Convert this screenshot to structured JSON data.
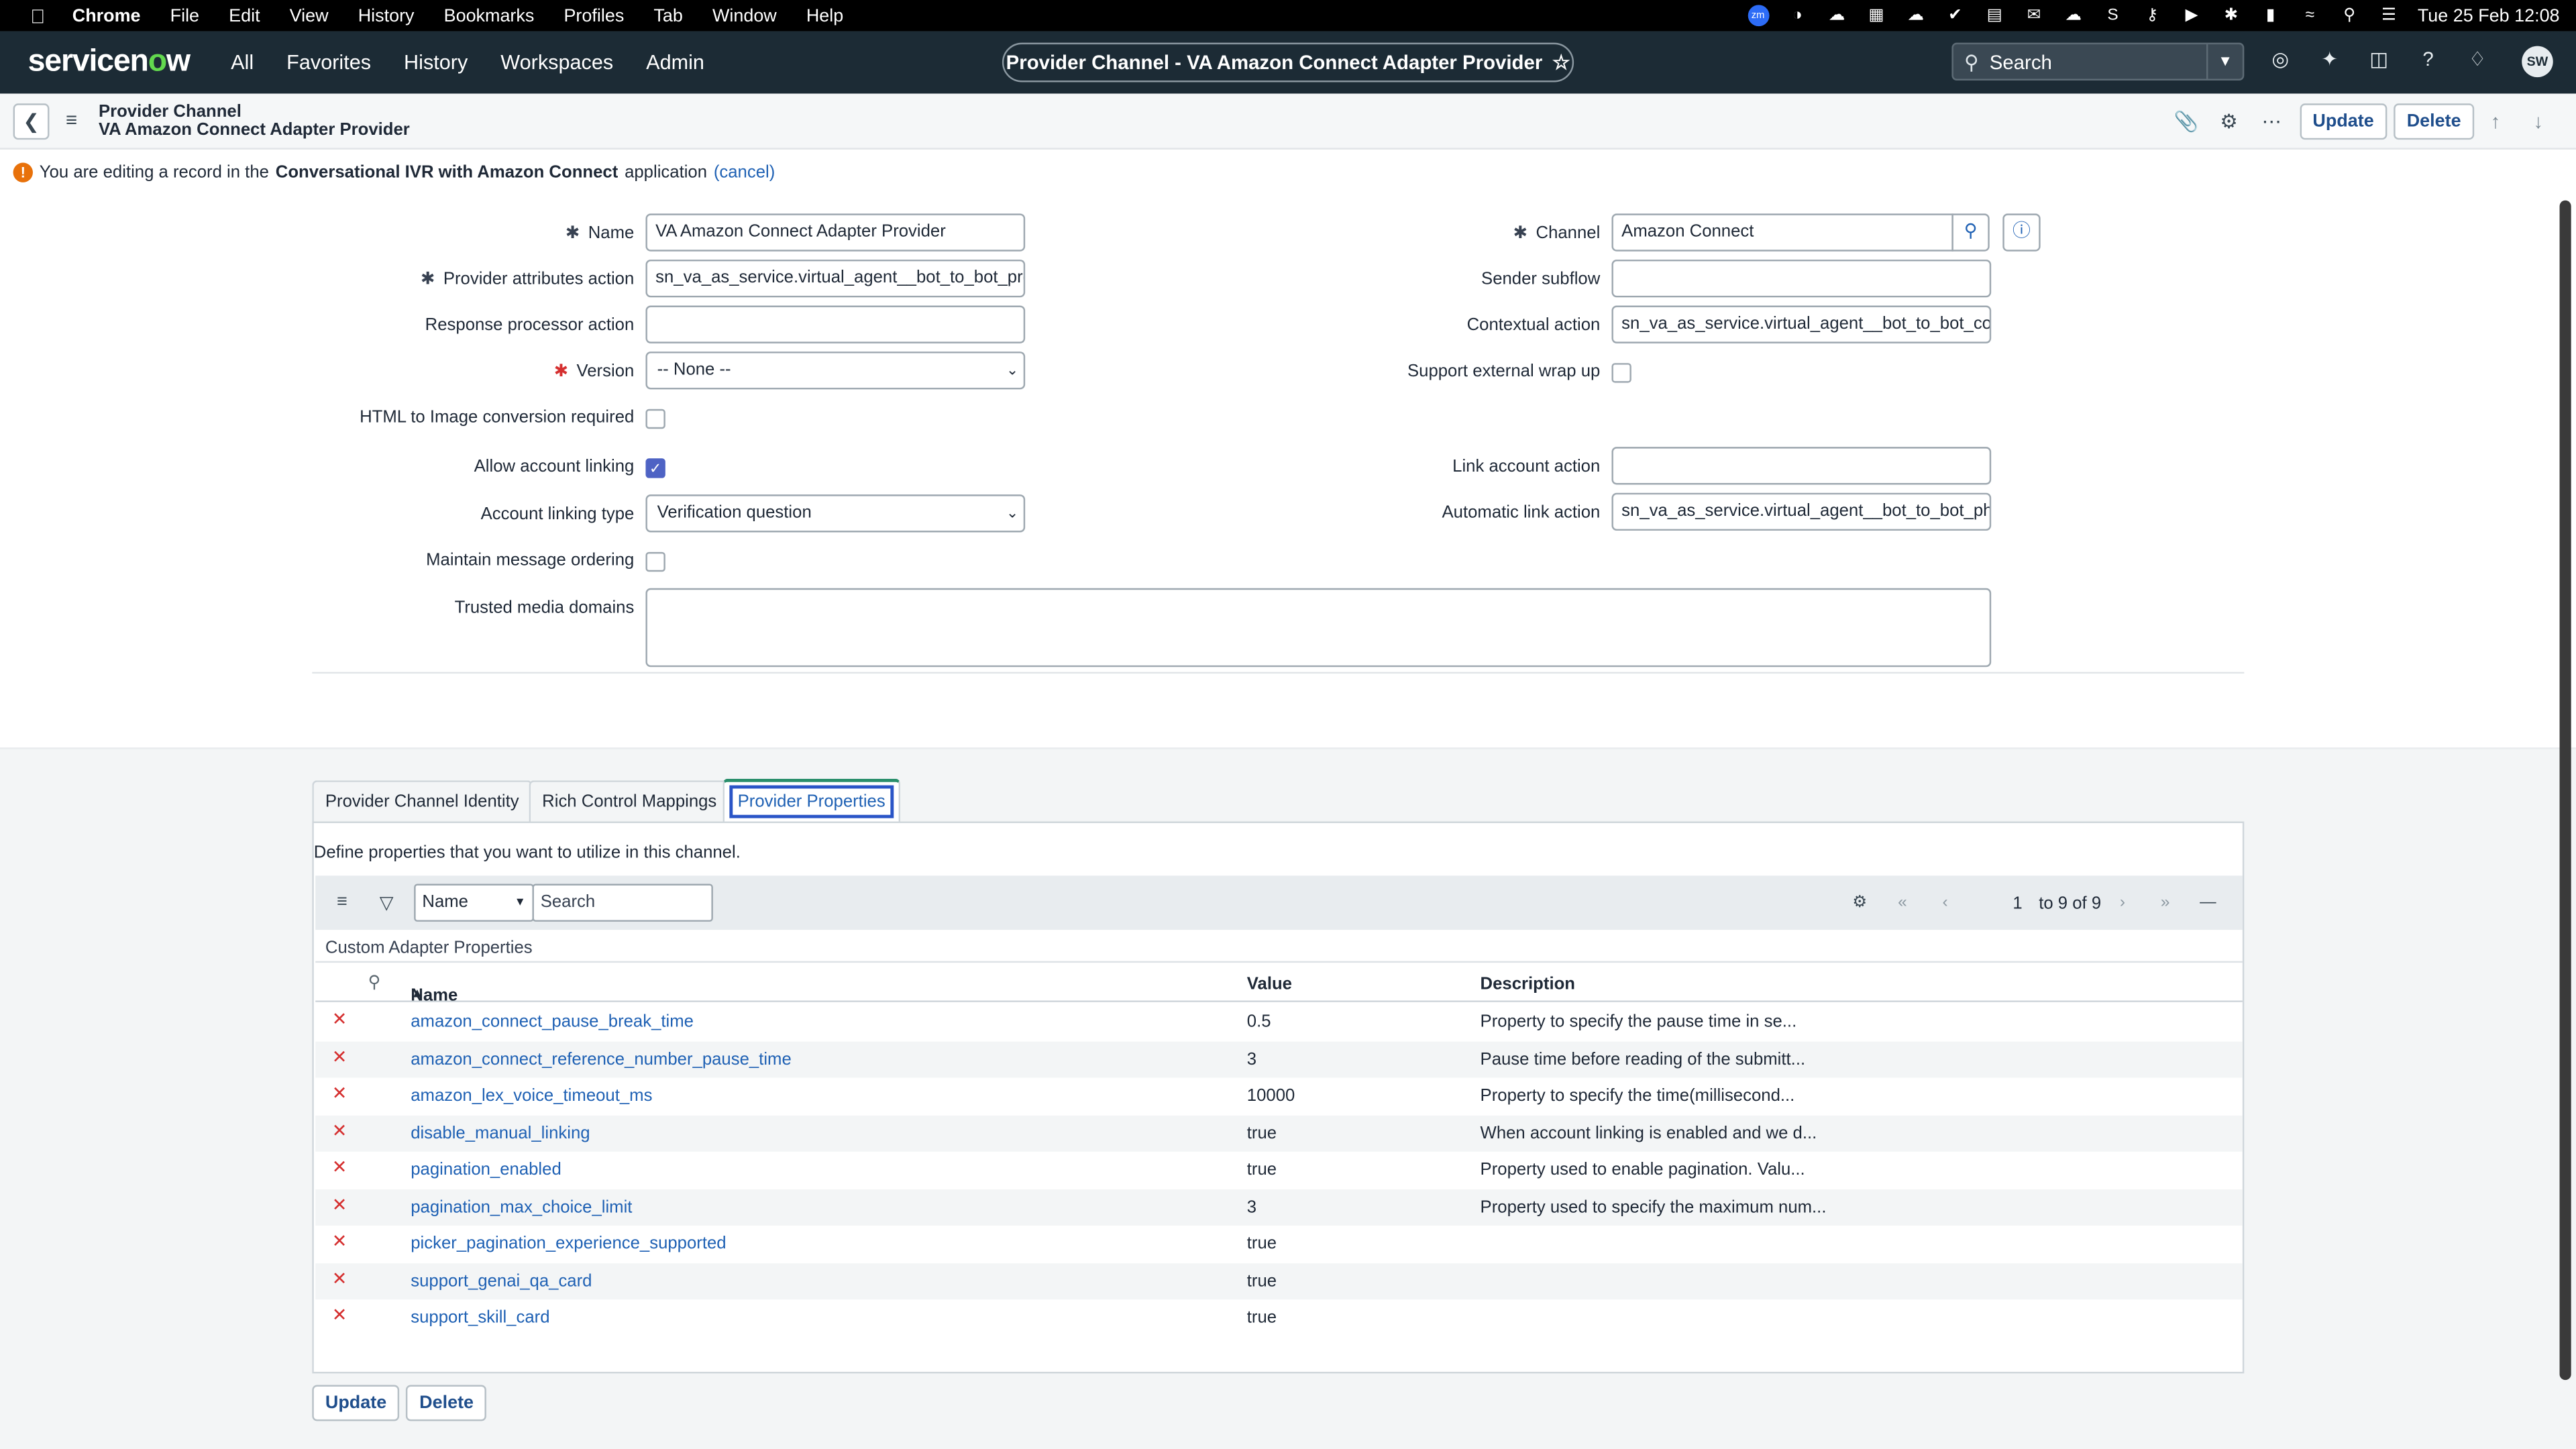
{
  "menubar": {
    "app": "Chrome",
    "items": [
      "File",
      "Edit",
      "View",
      "History",
      "Bookmarks",
      "Profiles",
      "Tab",
      "Window",
      "Help"
    ],
    "datetime": "Tue 25 Feb  12:08"
  },
  "header": {
    "logo_a": "servicen",
    "logo_b": "o",
    "logo_c": "w",
    "nav": [
      "All",
      "Favorites",
      "History",
      "Workspaces",
      "Admin"
    ],
    "context_title": "Provider Channel - VA Amazon Connect Adapter Provider",
    "search_placeholder": "Search",
    "avatar_initials": "SW"
  },
  "record": {
    "table": "Provider Channel",
    "name": "VA Amazon Connect Adapter Provider",
    "update_label": "Update",
    "delete_label": "Delete"
  },
  "notice": {
    "prefix": "You are editing a record in the",
    "app_name": "Conversational IVR with Amazon Connect",
    "suffix": "application",
    "cancel": "(cancel)"
  },
  "form": {
    "name_label": "Name",
    "name_value": "VA Amazon Connect Adapter Provider",
    "provider_attr_label": "Provider attributes action",
    "provider_attr_value": "sn_va_as_service.virtual_agent__bot_to_bot_provic",
    "response_proc_label": "Response processor action",
    "response_proc_value": "",
    "version_label": "Version",
    "version_value": "-- None --",
    "html_img_label": "HTML to Image conversion required",
    "allow_link_label": "Allow account linking",
    "link_type_label": "Account linking type",
    "link_type_value": "Verification question",
    "maintain_order_label": "Maintain message ordering",
    "trusted_label": "Trusted media domains",
    "trusted_value": "",
    "channel_label": "Channel",
    "channel_value": "Amazon Connect",
    "sender_label": "Sender subflow",
    "sender_value": "",
    "contextual_label": "Contextual action",
    "contextual_value": "sn_va_as_service.virtual_agent__bot_to_bot_conte:",
    "support_wrap_label": "Support external wrap up",
    "link_action_label": "Link account action",
    "link_action_value": "",
    "auto_link_label": "Automatic link action",
    "auto_link_value": "sn_va_as_service.virtual_agent__bot_to_bot_phone"
  },
  "tabs": [
    "Provider Channel Identity",
    "Rich Control Mappings",
    "Provider Properties"
  ],
  "related": {
    "description": "Define properties that you want to utilize in this channel.",
    "filter_field": "Name",
    "search_placeholder": "Search",
    "page_current": "1",
    "page_text": "to 9 of 9",
    "list_title": "Custom Adapter Properties",
    "columns": [
      "Name",
      "Value",
      "Description"
    ],
    "rows": [
      {
        "name": "amazon_connect_pause_break_time",
        "value": "0.5",
        "description": "Property to specify the pause time in se..."
      },
      {
        "name": "amazon_connect_reference_number_pause_time",
        "value": "3",
        "description": "Pause time before reading of the submitt..."
      },
      {
        "name": "amazon_lex_voice_timeout_ms",
        "value": "10000",
        "description": "Property to specify the time(millisecond..."
      },
      {
        "name": "disable_manual_linking",
        "value": "true",
        "description": "When account linking is enabled and we d..."
      },
      {
        "name": "pagination_enabled",
        "value": "true",
        "description": "Property used to enable pagination. Valu..."
      },
      {
        "name": "pagination_max_choice_limit",
        "value": "3",
        "description": "Property used to specify the maximum num..."
      },
      {
        "name": "picker_pagination_experience_supported",
        "value": "true",
        "description": ""
      },
      {
        "name": "support_genai_qa_card",
        "value": "true",
        "description": ""
      },
      {
        "name": "support_skill_card",
        "value": "true",
        "description": ""
      }
    ]
  },
  "colors": {
    "header_bg": "#1c2b35",
    "link": "#1f61b4",
    "accent_green": "#62d84e",
    "delete_red": "#d52f2f"
  }
}
